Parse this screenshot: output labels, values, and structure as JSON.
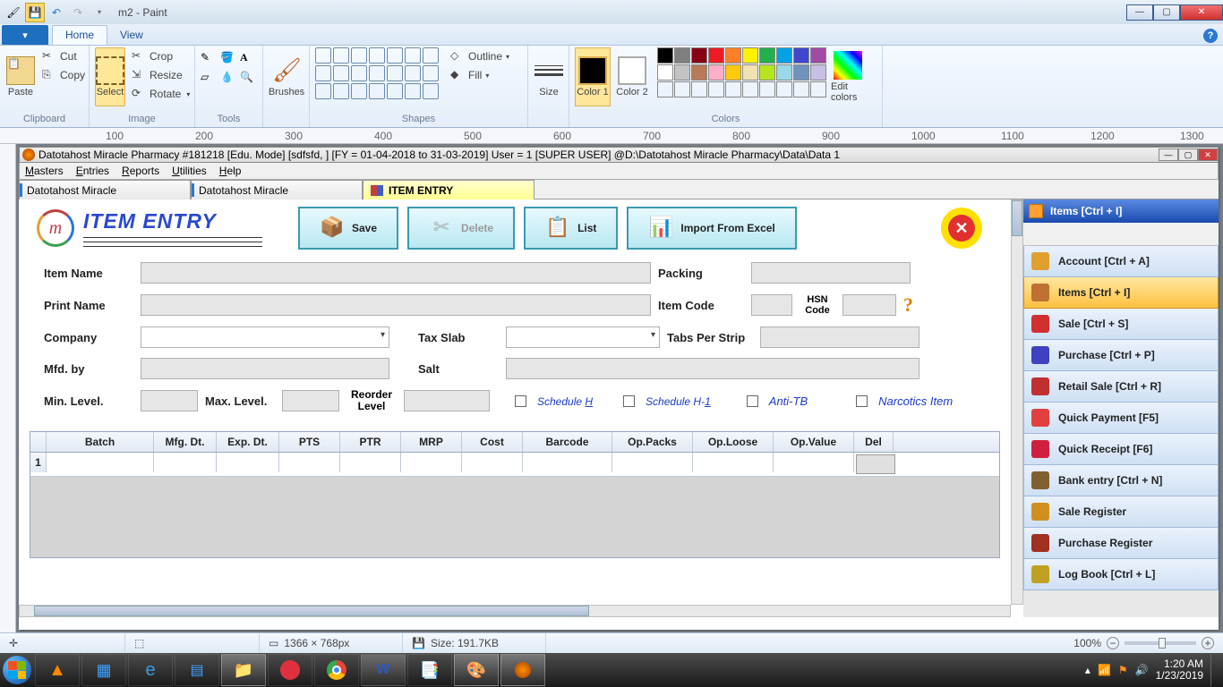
{
  "paint": {
    "title": "m2 - Paint",
    "tabs": {
      "file": "",
      "home": "Home",
      "view": "View"
    },
    "groups": {
      "clipboard": "Clipboard",
      "image": "Image",
      "tools": "Tools",
      "shapes": "Shapes",
      "size": "Size",
      "colors": "Colors"
    },
    "btns": {
      "paste": "Paste",
      "cut": "Cut",
      "copy": "Copy",
      "select": "Select",
      "crop": "Crop",
      "resize": "Resize",
      "rotate": "Rotate",
      "brushes": "Brushes",
      "outline": "Outline",
      "fill": "Fill",
      "size": "Size",
      "color1": "Color 1",
      "color2": "Color 2",
      "editcolors": "Edit colors"
    },
    "ruler_ticks": [
      "100",
      "200",
      "300",
      "400",
      "500",
      "600",
      "700",
      "800",
      "900",
      "1000",
      "1100",
      "1200",
      "1300"
    ],
    "status": {
      "dims": "1366 × 768px",
      "size": "Size: 191.7KB",
      "zoom": "100%"
    },
    "palette_row1": [
      "#000000",
      "#7f7f7f",
      "#880015",
      "#ed1c24",
      "#ff7f27",
      "#fff200",
      "#22b14c",
      "#00a2e8",
      "#3f48cc",
      "#a349a4"
    ],
    "palette_row2": [
      "#ffffff",
      "#c3c3c3",
      "#b97a57",
      "#ffaec9",
      "#ffc90e",
      "#efe4b0",
      "#b5e61d",
      "#99d9ea",
      "#7092be",
      "#c8bfe7"
    ]
  },
  "inner": {
    "title": "Datotahost Miracle Pharmacy #181218  [Edu. Mode]  [sdfsfd, ] [FY = 01-04-2018 to 31-03-2019] User = 1 [SUPER USER]  @D:\\Datotahost Miracle Pharmacy\\Data\\Data 1",
    "menu": [
      "Masters",
      "Entries",
      "Reports",
      "Utilities",
      "Help"
    ],
    "tabs": [
      "Datotahost Miracle",
      "Datotahost Miracle",
      "ITEM ENTRY"
    ]
  },
  "form": {
    "page_title": "ITEM ENTRY",
    "actions": {
      "save": "Save",
      "delete": "Delete",
      "list": "List",
      "import": "Import From Excel"
    },
    "labels": {
      "item_name": "Item Name",
      "packing": "Packing",
      "print_name": "Print Name",
      "item_code": "Item Code",
      "hsn": "HSN Code",
      "company": "Company",
      "tax_slab": "Tax Slab",
      "tabs_per_strip": "Tabs Per Strip",
      "mfd_by": "Mfd. by",
      "salt": "Salt",
      "min_level": "Min. Level.",
      "max_level": "Max. Level.",
      "reorder": "Reorder Level",
      "sched_h": "Schedule ",
      "sched_h_u": "H",
      "sched_h1": "Schedule H-",
      "sched_h1_u": "1",
      "anti_tb": "Anti-TB",
      "narcotics": "Narcotics Item"
    },
    "grid_headers": [
      "",
      "Batch",
      "Mfg. Dt.",
      "Exp. Dt.",
      "PTS",
      "PTR",
      "MRP",
      "Cost",
      "Barcode",
      "Op.Packs",
      "Op.Loose",
      "Op.Value",
      "Del"
    ],
    "grid_rownum": "1"
  },
  "side": {
    "header": "Items [Ctrl + I]",
    "items": [
      {
        "label": "Account [Ctrl + A]",
        "color": "#e0a030"
      },
      {
        "label": "Items [Ctrl + I]",
        "color": "#c07030",
        "active": true
      },
      {
        "label": "Sale [Ctrl + S]",
        "color": "#d03030"
      },
      {
        "label": "Purchase [Ctrl + P]",
        "color": "#4040c0"
      },
      {
        "label": "Retail Sale [Ctrl + R]",
        "color": "#c03030"
      },
      {
        "label": "Quick Payment [F5]",
        "color": "#e04040"
      },
      {
        "label": "Quick Receipt [F6]",
        "color": "#d02040"
      },
      {
        "label": "Bank entry [Ctrl + N]",
        "color": "#806030"
      },
      {
        "label": "Sale Register",
        "color": "#d09020"
      },
      {
        "label": "Purchase Register",
        "color": "#a03020"
      },
      {
        "label": "Log Book [Ctrl + L]",
        "color": "#c0a020"
      }
    ]
  },
  "taskbar": {
    "time": "1:20 AM",
    "date": "1/23/2019"
  }
}
